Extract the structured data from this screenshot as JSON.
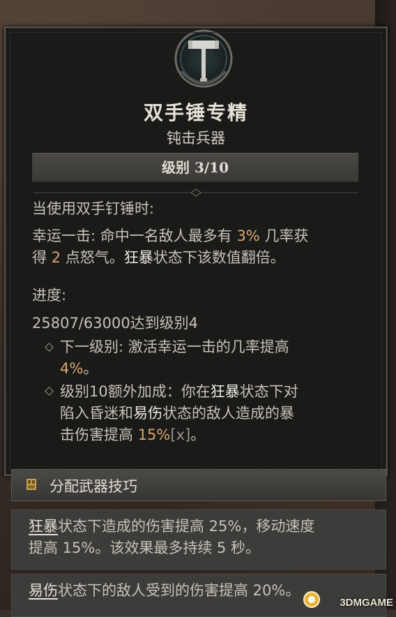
{
  "skill": {
    "title": "双手锤专精",
    "category": "钝击兵器",
    "rank_label": "级别 3/10"
  },
  "description": {
    "condition": "当使用双手钉锤时:",
    "line1_prefix": "幸运一击: 命中一名敌人最多有",
    "line1_chance": "3%",
    "line1_suffix": "几率获",
    "line2_prefix": "得",
    "line2_amount": "2",
    "line2_mid": "点怒气。",
    "line2_keyword": "狂暴",
    "line2_suffix": "状态下该数值翻倍。"
  },
  "progress": {
    "heading": "进度:",
    "value": "25807/63000达到级别4",
    "bullet1_line1": "下一级别: 激活幸运一击的几率提高",
    "bullet1_value": "4%",
    "bullet1_end": "。",
    "bullet2_line1_a": "级别10额外加成：你在",
    "bullet2_line1_kw": "狂暴",
    "bullet2_line1_b": "状态下对",
    "bullet2_line2_a": "陷入昏迷和",
    "bullet2_line2_kw": "易伤",
    "bullet2_line2_b": "状态的敌人造成的暴",
    "bullet2_line3_a": "击伤害提高",
    "bullet2_line3_val": "15%",
    "bullet2_line3_x": "[x]",
    "bullet2_line3_end": "。"
  },
  "section": {
    "label": "分配武器技巧"
  },
  "glossary": {
    "berserk_term": "狂暴",
    "berserk_line1": "状态下造成的伤害提高 25%，移动速度",
    "berserk_line2": "提高 15%。该效果最多持续 5 秒。",
    "vulnerable_term": "易伤",
    "vulnerable_line1": "状态下的敌人受到的伤害提高 20%。"
  },
  "watermark": {
    "text": "3DMGAME"
  },
  "colors": {
    "highlight": "#d9a86a",
    "panel_bg": "#1a1a19",
    "border": "#55524c"
  },
  "icons": {
    "emblem": "hammer-emblem-icon",
    "bullet": "diamond-bullet-icon",
    "section": "weapon-technique-icon"
  }
}
